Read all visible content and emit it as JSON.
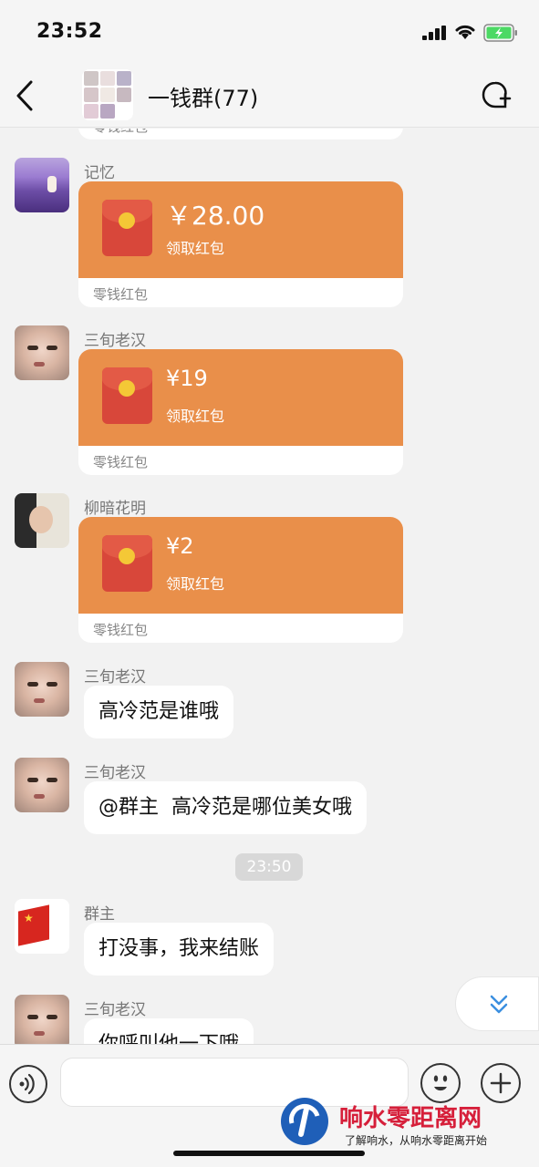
{
  "status_bar": {
    "time": "23:52"
  },
  "header": {
    "title": "一钱群(77)"
  },
  "messages": [
    {
      "sender": "记忆",
      "amount": "￥28.00",
      "claim": "领取红包",
      "footer": "零钱红包"
    },
    {
      "sender": "三旬老汉",
      "amount": "¥19",
      "claim": "领取红包",
      "footer": "零钱红包"
    },
    {
      "sender": "柳暗花明",
      "amount": "¥2",
      "claim": "领取红包",
      "footer": "零钱红包"
    },
    {
      "sender": "三旬老汉",
      "text": "高冷范是谁哦"
    },
    {
      "sender": "三旬老汉",
      "text": "@群主  高冷范是哪位美女哦"
    },
    {
      "sender": "群主",
      "text": "打没事，我来结账"
    },
    {
      "sender": "三旬老汉",
      "text": "你呼叫他一下哦"
    }
  ],
  "top_partial_footer": "零钱红包",
  "timestamp": "23:50",
  "input": {
    "value": "",
    "placeholder": ""
  },
  "watermark": {
    "title": "响水零距离网",
    "subtitle": "了解响水，从响水零距离开始"
  },
  "colors": {
    "red_packet": "#e98f4a",
    "packet_icon": "#d8473a",
    "watermark": "#d61f3a"
  },
  "icons": [
    "back-icon",
    "new-chat-icon",
    "voice-icon",
    "emoji-icon",
    "plus-icon",
    "scroll-down-icon"
  ]
}
